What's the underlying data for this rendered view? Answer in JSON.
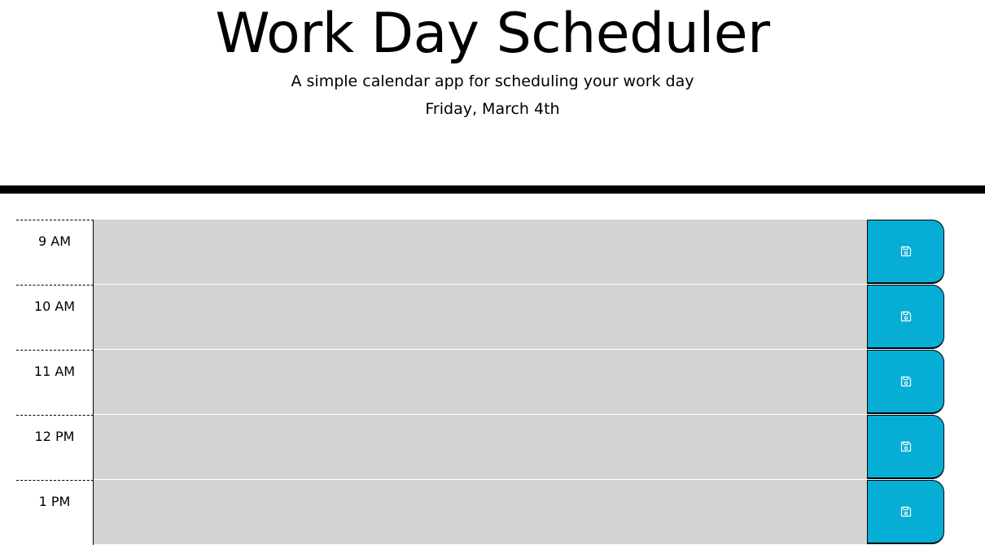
{
  "header": {
    "title": "Work Day Scheduler",
    "subtitle": "A simple calendar app for scheduling your work day",
    "current_day": "Friday, March 4th"
  },
  "time_blocks": [
    {
      "hour": "9 AM",
      "description": ""
    },
    {
      "hour": "10 AM",
      "description": ""
    },
    {
      "hour": "11 AM",
      "description": ""
    },
    {
      "hour": "12 PM",
      "description": ""
    },
    {
      "hour": "1 PM",
      "description": ""
    }
  ],
  "icons": {
    "save": "floppy-disk-icon"
  },
  "colors": {
    "past_block": "#d3d3d3",
    "save_button": "#06aed5",
    "save_icon": "#ffffff",
    "header_rule": "#000000"
  }
}
